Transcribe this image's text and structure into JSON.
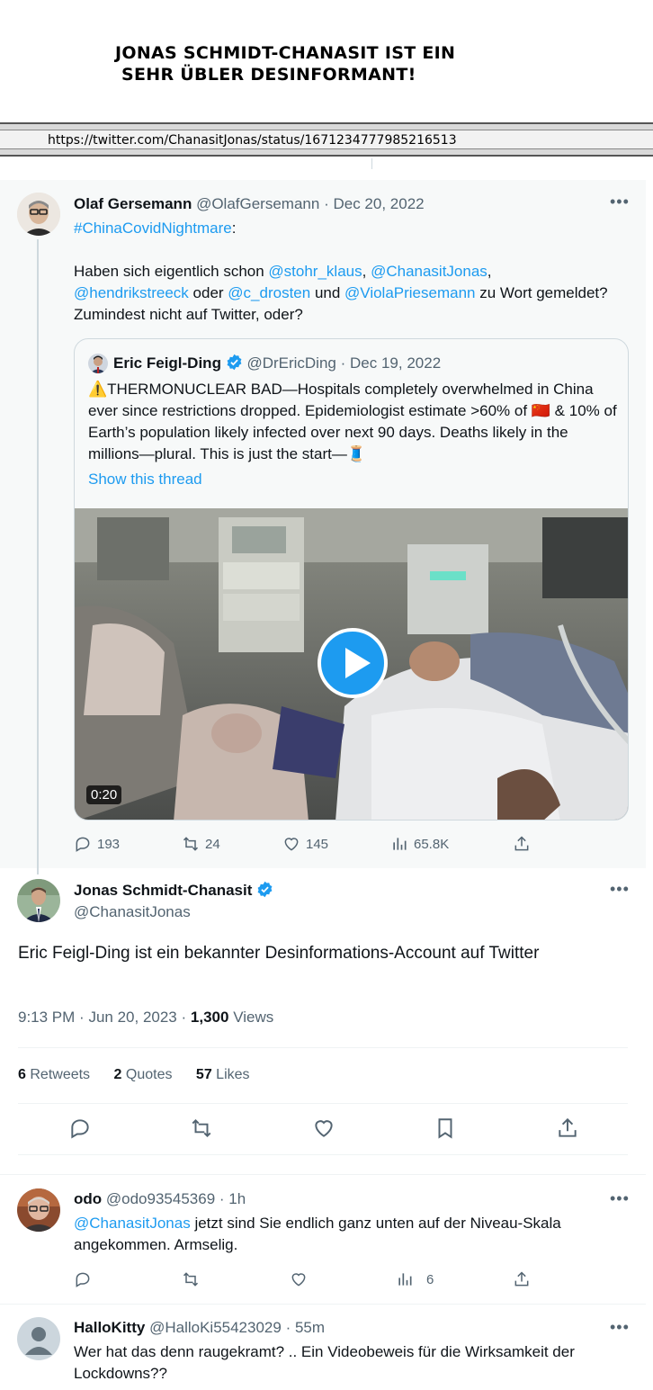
{
  "headline": {
    "line1": "JONAS SCHMIDT-CHANASIT IST EIN",
    "line2": "SEHR ÜBLER DESINFORMANT!"
  },
  "url_bar": {
    "url": "https://twitter.com/ChanasitJonas/status/1671234777985216513"
  },
  "quoted_tweet": {
    "author_name": "Olaf Gersemann",
    "author_handle": "@OlafGersemann",
    "date": "Dec 20, 2022",
    "hashtag": "#ChinaCovidNightmare",
    "hashtag_suffix": ":",
    "line1_prefix": "Haben sich eigentlich schon ",
    "mention1": "@stohr_klaus",
    "comma1": ", ",
    "mention2": "@ChanasitJonas",
    "comma2": ",",
    "mention3": "@hendrikstreeck",
    "oder": " oder ",
    "mention4": "@c_drosten",
    "und": " und ",
    "mention5": "@ViolaPriesemann",
    "line_end": " zu Wort gemeldet? Zumindest nicht auf Twitter, oder?",
    "embed": {
      "author_name": "Eric Feigl-Ding",
      "author_handle": "@DrEricDing",
      "date": "Dec 19, 2022",
      "warning_icon": "⚠️",
      "text_a": "THERMONUCLEAR BAD—Hospitals completely overwhelmed in China ever since restrictions dropped. Epidemiologist estimate >60% of ",
      "flag": "🇨🇳",
      "text_b": " & 10% of Earth’s population likely infected over next 90 days. Deaths likely in the millions—plural. This is just the start—",
      "thread_icon": "🧵",
      "show_thread": "Show this thread",
      "video_duration": "0:20"
    },
    "stats": {
      "replies": "193",
      "retweets": "24",
      "likes": "145",
      "views": "65.8K"
    }
  },
  "main_tweet": {
    "author_name": "Jonas Schmidt-Chanasit",
    "author_handle": "@ChanasitJonas",
    "text": "Eric Feigl-Ding ist ein bekannter Desinformations-Account auf Twitter",
    "time": "9:13 PM",
    "date": "Jun 20, 2023",
    "views_count": "1,300",
    "views_label": "Views",
    "retweets_count": "6",
    "retweets_label": "Retweets",
    "quotes_count": "2",
    "quotes_label": "Quotes",
    "likes_count": "57",
    "likes_label": "Likes"
  },
  "replies": [
    {
      "author_name": "odo",
      "author_handle": "@odo93545369",
      "time": "1h",
      "mention": "@ChanasitJonas",
      "text": " jetzt sind Sie endlich ganz unten auf der Niveau-Skala angekommen. Armselig.",
      "views": "6"
    },
    {
      "author_name": "HalloKitty",
      "author_handle": "@HalloKi55423029",
      "time": "55m",
      "text": "Wer hat das denn raugekramt? .. Ein Videobeweis für die Wirksamkeit der Lockdowns??"
    }
  ],
  "colors": {
    "accent": "#1d9bf0",
    "text": "#0f1419",
    "muted": "#536471",
    "verified": "#1d9bf0"
  },
  "icons": [
    "more-icon",
    "verified-badge-icon",
    "reply-icon",
    "retweet-icon",
    "like-icon",
    "views-icon",
    "share-icon",
    "bookmark-icon",
    "play-icon"
  ]
}
